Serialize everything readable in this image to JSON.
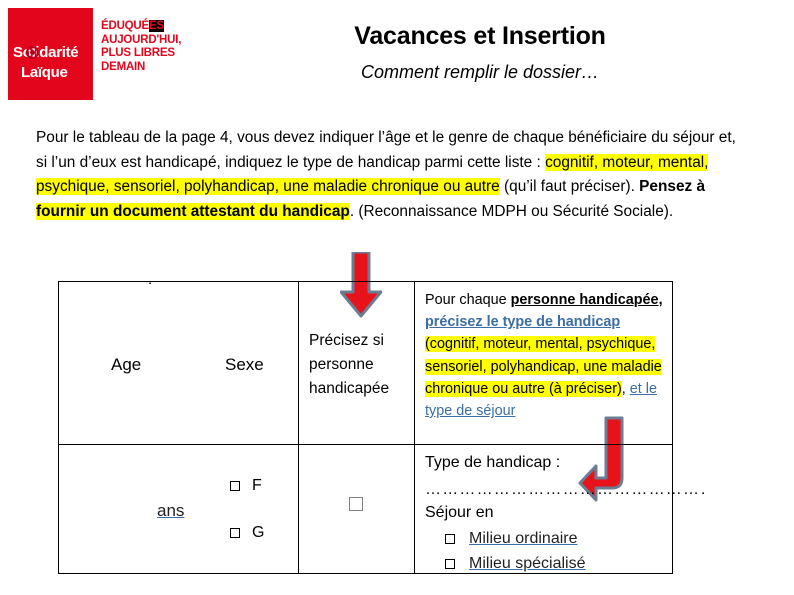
{
  "header": {
    "logo": {
      "name_line1": "Solidarité",
      "name_line2": "Laïque",
      "tagline_line1_a": "ÉDUQUÉ",
      "tagline_line1_b": "ES",
      "tagline_line2": "AUJOURD'HUI,",
      "tagline_line3": "PLUS LIBRES",
      "tagline_line4": "DEMAIN"
    },
    "title": "Vacances et Insertion",
    "subtitle": "Comment remplir le dossier…"
  },
  "paragraph": {
    "seg1": "Pour le tableau de la page 4, vous devez indiquer l’âge et le genre de chaque bénéficiaire du séjour et, si l’un d’eux est handicapé, indiquez le type de handicap parmi cette liste : ",
    "seg_highlight1": "cognitif, moteur, mental, psychique, sensoriel, polyhandicap, une maladie chronique ou autre",
    "seg2": " (qu’il faut préciser).",
    "seg_bold_prefix": "Pensez à ",
    "seg_bold_highlight": "fournir un document attestant du handicap",
    "seg3": ". (Reconnaissance MDPH ou Sécurité Sociale)."
  },
  "arrows": {
    "down_arrow": "red-down-arrow",
    "elbow_arrow": "red-elbow-arrow",
    "fill_color": "#e8121a",
    "outline_color": "#6b7c93"
  },
  "table": {
    "stray_mark": ".",
    "header_row": {
      "age": "Age",
      "sexe": "Sexe",
      "precisez": "Précisez si personne handicapée",
      "handicap_cell": {
        "t1": "Pour chaque ",
        "t2_bold_underline": "personne handicapée",
        "t3": ", ",
        "t4_blue": "précisez  le type de handicap",
        "t5_highlight": " (cognitif, moteur, mental, psychique, sensoriel, polyhandicap, une maladie chronique ou autre (à préciser)",
        "t6": ", ",
        "t7_blue": "et le type de séjour"
      }
    },
    "data_row": {
      "ans": "ans",
      "sexe_option_f": "F",
      "sexe_option_g": "G",
      "handicap_checkbox": "empty-checkbox",
      "type_label": "Type de handicap :",
      "dotted_line": "……………………………………………",
      "sejour_label": "Séjour en",
      "sejour_option1": "Milieu  ordinaire",
      "sejour_option2": "Milieu  spécialisé"
    }
  }
}
